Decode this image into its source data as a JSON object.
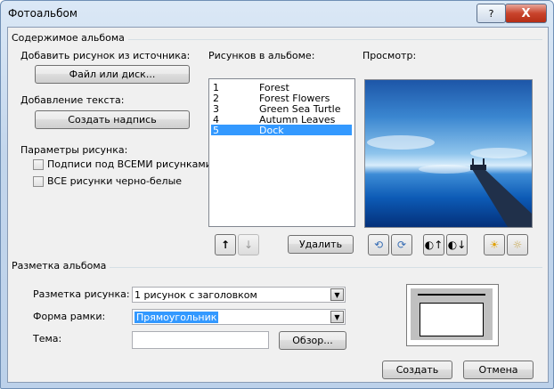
{
  "window": {
    "title": "Фотоальбом",
    "help_label": "?",
    "close_label": "X"
  },
  "content_group": {
    "title": "Содержимое альбома"
  },
  "add_source": {
    "label": "Добавить рисунок из источника:",
    "button": "Файл или диск..."
  },
  "add_text": {
    "label": "Добавление текста:",
    "button": "Создать надпись"
  },
  "picture_params": {
    "label": "Параметры рисунка:",
    "captions": {
      "label": "Подписи под ВСЕМИ рисунками",
      "checked": false
    },
    "bw": {
      "label": "ВСЕ рисунки черно-белые",
      "checked": false
    }
  },
  "album_list": {
    "label": "Рисунков в альбоме:",
    "items": [
      {
        "num": "1",
        "name": "Forest",
        "selected": false
      },
      {
        "num": "2",
        "name": "Forest Flowers",
        "selected": false
      },
      {
        "num": "3",
        "name": "Green Sea Turtle",
        "selected": false
      },
      {
        "num": "4",
        "name": "Autumn Leaves",
        "selected": false
      },
      {
        "num": "5",
        "name": "Dock",
        "selected": true
      }
    ],
    "move_up": "↑",
    "move_down": "↓",
    "delete_button": "Удалить"
  },
  "preview": {
    "label": "Просмотр:"
  },
  "layout_group": {
    "title": "Разметка альбома",
    "picture_layout": {
      "label": "Разметка рисунка:",
      "value": "1 рисунок с заголовком"
    },
    "frame_shape": {
      "label": "Форма рамки:",
      "value": "Прямоугольник"
    },
    "theme": {
      "label": "Тема:",
      "value": "",
      "browse_button": "Обзор..."
    }
  },
  "footer": {
    "create_button": "Создать",
    "cancel_button": "Отмена"
  }
}
